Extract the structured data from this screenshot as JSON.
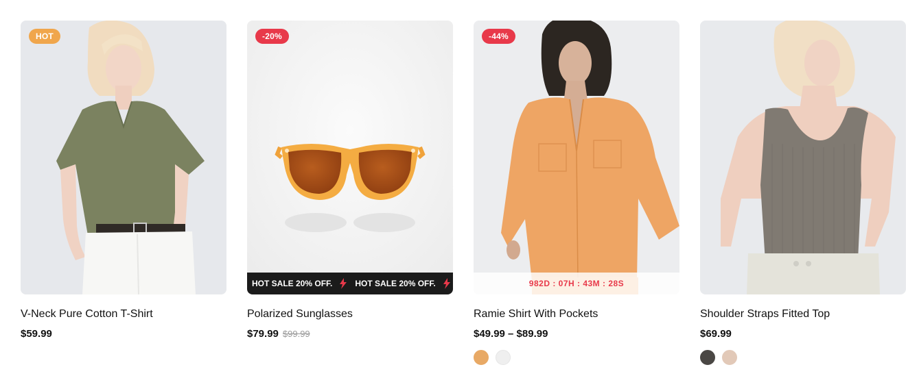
{
  "products": [
    {
      "badge": "HOT",
      "name": "V-Neck Pure Cotton T-Shirt",
      "price": "$59.99",
      "image": "woman-olive-tshirt"
    },
    {
      "badge": "-20%",
      "name": "Polarized Sunglasses",
      "price": "$79.99",
      "old_price": "$99.99",
      "image": "amber-sunglasses",
      "marquee_text": "HOT SALE  20% OFF."
    },
    {
      "badge": "-44%",
      "name": "Ramie Shirt With Pockets",
      "price": "$49.99 – $89.99",
      "image": "woman-orange-shirt",
      "countdown": "982D : 07H : 43M : 28S",
      "swatches": [
        {
          "color": "#e8a965",
          "name": "orange"
        },
        {
          "color": "#efefef",
          "name": "white"
        }
      ]
    },
    {
      "name": "Shoulder Straps Fitted Top",
      "price": "$69.99",
      "image": "woman-grey-tank-top",
      "swatches": [
        {
          "color": "#4a4744",
          "name": "dark-grey"
        },
        {
          "color": "#e2c9b8",
          "name": "beige"
        }
      ]
    }
  ],
  "colors": {
    "hot_badge": "#f0a64c",
    "sale_badge": "#e8394a",
    "countdown_text": "#e8394a",
    "marquee_bg": "#1b1b1b"
  }
}
